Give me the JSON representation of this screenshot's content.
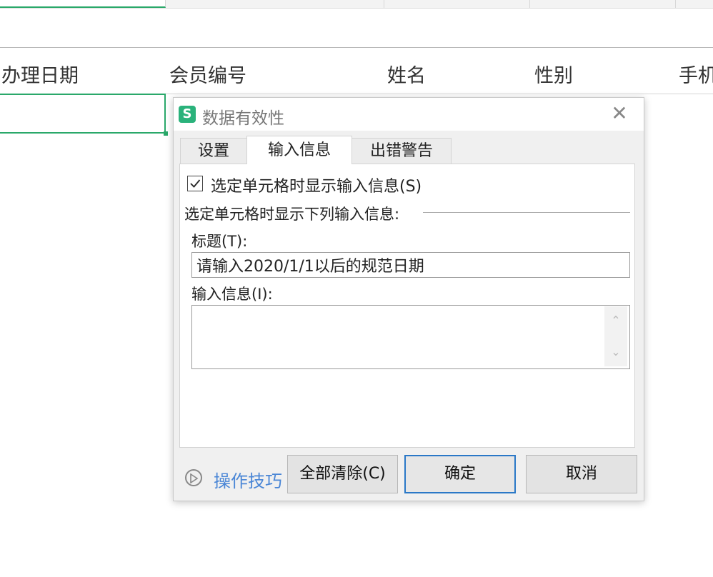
{
  "sheet": {
    "headers": [
      "办理日期",
      "会员编号",
      "姓名",
      "性别",
      "手机"
    ]
  },
  "dialog": {
    "app_icon_letter": "S",
    "title": "数据有效性",
    "close_glyph": "✕",
    "tabs": [
      {
        "label": "设置"
      },
      {
        "label": "输入信息"
      },
      {
        "label": "出错警告"
      }
    ],
    "show_input_checkbox_label": "选定单元格时显示输入信息(S)",
    "show_input_checked": true,
    "group_label": "选定单元格时显示下列输入信息:",
    "title_field_label": "标题(T):",
    "title_field_value": "请输入2020/1/1以后的规范日期",
    "message_field_label": "输入信息(I):",
    "message_field_value": "",
    "scroll_up_glyph": "⌃",
    "scroll_down_glyph": "⌄",
    "tips_label": "操作技巧",
    "clear_all_button": "全部清除(C)",
    "ok_button": "确定",
    "cancel_button": "取消"
  },
  "colors": {
    "accent_green": "#2aa86a",
    "link_blue": "#4a86d6",
    "default_button_border": "#2a78c7"
  }
}
